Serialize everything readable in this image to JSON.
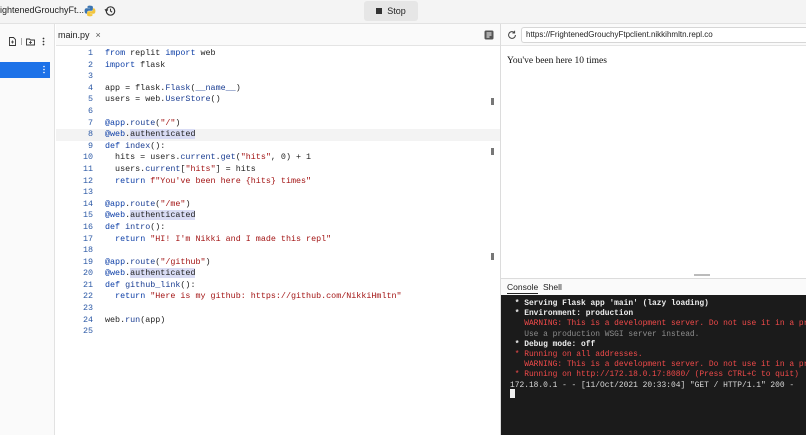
{
  "topbar": {
    "repl_name": "ightenedGrouchyFt...",
    "stop_label": "Stop"
  },
  "icons": {
    "python": "python-logo-icon",
    "history": "history-icon",
    "new_file": "new-file-icon",
    "new_folder": "new-folder-icon",
    "more": "kebab-menu-icon"
  },
  "editor": {
    "tab_label": "main.py",
    "tab_close": "×",
    "lines": [
      {
        "n": "1",
        "html": "<span class='k'>from</span> replit <span class='k'>import</span> web"
      },
      {
        "n": "2",
        "html": "<span class='k'>import</span> flask"
      },
      {
        "n": "3",
        "html": ""
      },
      {
        "n": "4",
        "html": "app = flask.<span class='attr'>Flask</span>(<span class='attr'>__name__</span>)"
      },
      {
        "n": "5",
        "html": "users = web.<span class='attr'>UserStore</span>()"
      },
      {
        "n": "6",
        "html": ""
      },
      {
        "n": "7",
        "html": "<span class='d'>@app</span>.<span class='attr'>route</span>(<span class='s'>\"/\"</span>)"
      },
      {
        "n": "8",
        "html": "<span class='d'>@web</span>.<span class='hl'>authenticated</span>",
        "active": true
      },
      {
        "n": "9",
        "html": "<span class='k'>def</span> <span class='attr'>index</span>():"
      },
      {
        "n": "10",
        "html": "  hits = users.<span class='attr'>current</span>.<span class='attr'>get</span>(<span class='s'>\"hits\"</span>, 0) + 1"
      },
      {
        "n": "11",
        "html": "  users.<span class='attr'>current</span>[<span class='s'>\"hits\"</span>] = hits"
      },
      {
        "n": "12",
        "html": "  <span class='k'>return</span> <span class='s'>f\"You've been here {hits} times\"</span>"
      },
      {
        "n": "13",
        "html": ""
      },
      {
        "n": "14",
        "html": "<span class='d'>@app</span>.<span class='attr'>route</span>(<span class='s'>\"/me\"</span>)"
      },
      {
        "n": "15",
        "html": "<span class='d'>@web</span>.<span class='hl'>authenticated</span>"
      },
      {
        "n": "16",
        "html": "<span class='k'>def</span> <span class='attr'>intro</span>():"
      },
      {
        "n": "17",
        "html": "  <span class='k'>return</span> <span class='s'>\"HI! I'm Nikki and I made this repl\"</span>"
      },
      {
        "n": "18",
        "html": ""
      },
      {
        "n": "19",
        "html": "<span class='d'>@app</span>.<span class='attr'>route</span>(<span class='s'>\"/github\"</span>)"
      },
      {
        "n": "20",
        "html": "<span class='d'>@web</span>.<span class='hl'>authenticated</span>"
      },
      {
        "n": "21",
        "html": "<span class='k'>def</span> <span class='attr'>github_link</span>():"
      },
      {
        "n": "22",
        "html": "  <span class='k'>return</span> <span class='s'>\"Here is my github: https://github.com/NikkiHmltn\"</span>"
      },
      {
        "n": "23",
        "html": ""
      },
      {
        "n": "24",
        "html": "web.<span class='attr'>run</span>(app)"
      },
      {
        "n": "25",
        "html": ""
      }
    ]
  },
  "browser": {
    "url": "https://FrightenedGrouchyFtpclient.nikkihmltn.repl.co",
    "output": "You've been here 10 times"
  },
  "console": {
    "tabs": [
      "Console",
      "Shell"
    ],
    "lines": [
      {
        "cls": "w",
        "text": " * Serving Flask app 'main' (lazy loading)"
      },
      {
        "cls": "w",
        "text": " * Environment: production"
      },
      {
        "cls": "r",
        "text": "   WARNING: This is a development server. Do not use it in a production deployment."
      },
      {
        "cls": "g",
        "text": "   Use a production WSGI server instead."
      },
      {
        "cls": "w",
        "text": " * Debug mode: off"
      },
      {
        "cls": "r",
        "text": " * Running on all addresses."
      },
      {
        "cls": "r",
        "text": "   WARNING: This is a development server. Do not use it in a production deployment."
      },
      {
        "cls": "r",
        "text": " * Running on http://172.18.0.17:8080/ (Press CTRL+C to quit)"
      },
      {
        "cls": "p",
        "text": "172.18.0.1 - - [11/Oct/2021 20:33:04] \"GET / HTTP/1.1\" 200 -"
      }
    ]
  }
}
